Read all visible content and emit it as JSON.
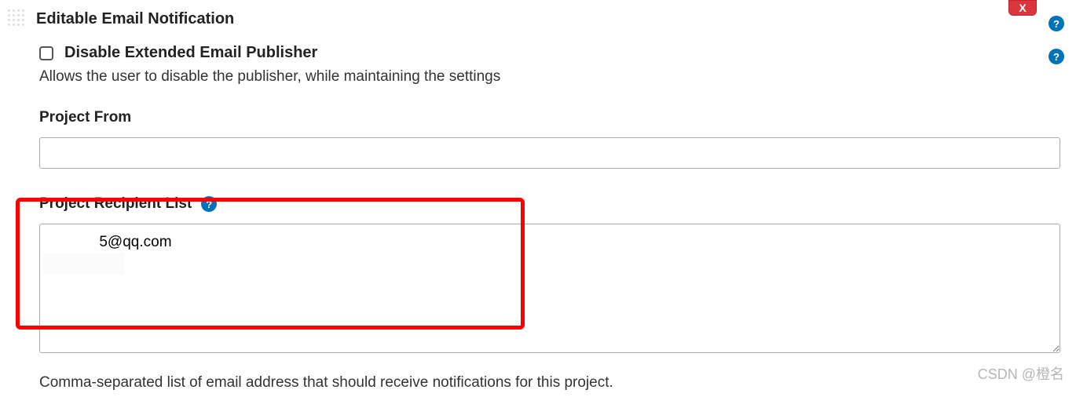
{
  "section": {
    "title": "Editable Email Notification",
    "delete_label": "X"
  },
  "disable": {
    "label": "Disable Extended Email Publisher",
    "description": "Allows the user to disable the publisher, while maintaining the settings"
  },
  "project_from": {
    "label": "Project From",
    "value": ""
  },
  "project_recipients": {
    "label": "Project Recipient List",
    "value": "            5@qq.com",
    "description": "Comma-separated list of email address that should receive notifications for this project."
  },
  "help_glyph": "?",
  "watermark": "CSDN @橙名"
}
